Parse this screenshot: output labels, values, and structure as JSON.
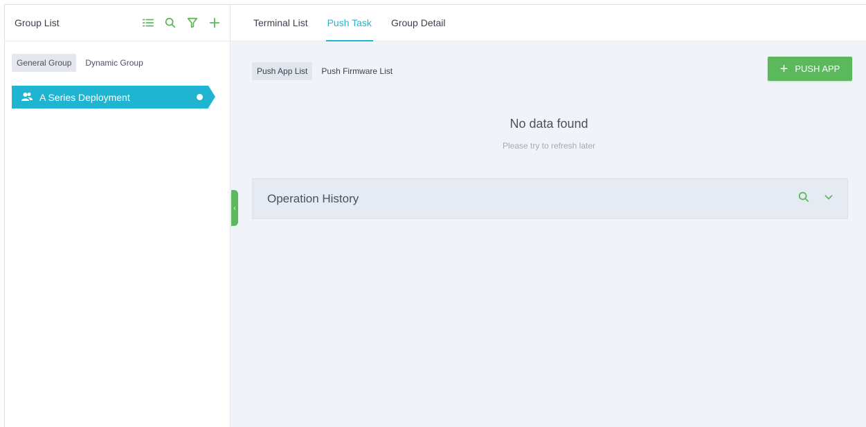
{
  "left_panel": {
    "title": "Group List",
    "header_icons": [
      "list-icon",
      "search-icon",
      "filter-icon",
      "add-icon"
    ],
    "group_tabs": [
      {
        "label": "General Group",
        "active": true
      },
      {
        "label": "Dynamic Group",
        "active": false
      }
    ],
    "groups": [
      {
        "label": "A Series Deployment",
        "selected": true
      }
    ]
  },
  "top_tabs": [
    {
      "label": "Terminal List",
      "active": false
    },
    {
      "label": "Push Task",
      "active": true
    },
    {
      "label": "Group Detail",
      "active": false
    }
  ],
  "sub_tabs": [
    {
      "label": "Push App List",
      "active": true
    },
    {
      "label": "Push Firmware List",
      "active": false
    }
  ],
  "push_button": {
    "label": "PUSH APP"
  },
  "empty_state": {
    "title": "No data found",
    "subtitle": "Please try to refresh later"
  },
  "operation_history": {
    "title": "Operation History"
  },
  "colors": {
    "accent": "#1fb5d2",
    "green": "#5cb85c"
  }
}
